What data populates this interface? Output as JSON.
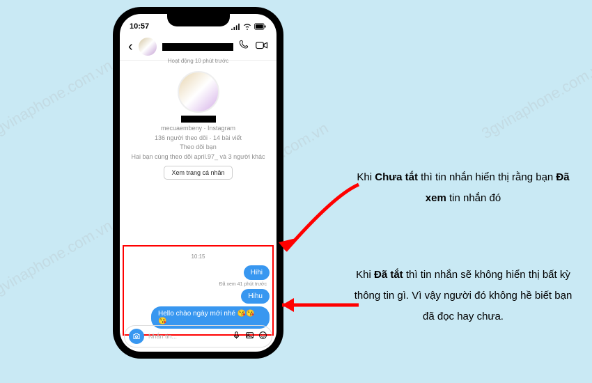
{
  "statusbar": {
    "time": "10:57"
  },
  "header": {
    "activity": "Hoạt động 10 phút trước"
  },
  "profile": {
    "handle": "mecuaembeny · Instagram",
    "stats": "136 người theo dõi · 14 bài viết",
    "follow_status": "Theo dõi bạn",
    "mutuals": "Hai bạn cùng theo dõi april.97_ và 3 người khác",
    "view_button": "Xem trang cá nhân"
  },
  "chat": {
    "timestamp": "10:15",
    "messages": [
      {
        "text": "Hihi"
      },
      {
        "text": "Hihu"
      },
      {
        "text": "Hello chào ngày mới nhé 😘😘😘"
      }
    ],
    "seen_label": "Đã xem 41 phút trước"
  },
  "composer": {
    "placeholder": "Nhắn tin..."
  },
  "annotations": {
    "a1_p1": "Khi ",
    "a1_b1": "Chưa tắt",
    "a1_p2": " thì tin nhắn hiển thị rằng bạn ",
    "a1_b2": "Đã xem",
    "a1_p3": " tin nhắn đó",
    "a2_p1": "Khi ",
    "a2_b1": "Đã tắt",
    "a2_p2": " thì tin nhắn sẽ không hiển thị bất kỳ thông tin gì. Vì vậy người đó không hề biết bạn đã đọc hay chưa."
  }
}
